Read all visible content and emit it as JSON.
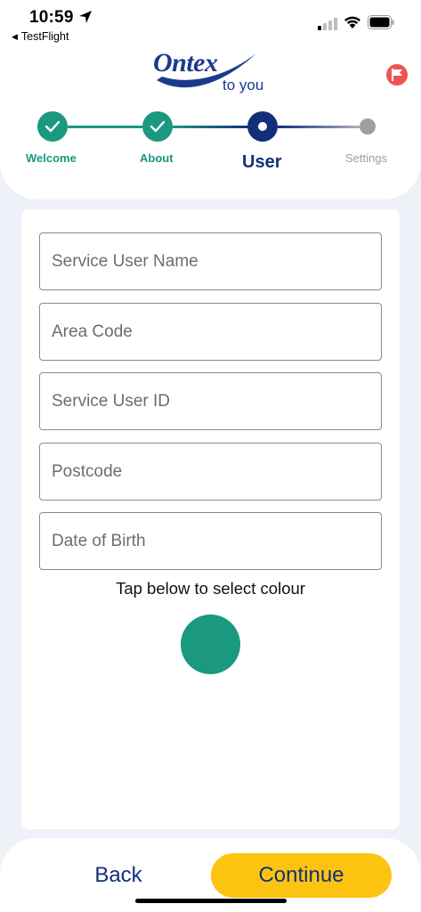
{
  "status_bar": {
    "time": "10:59",
    "back_app": "TestFlight",
    "location_icon": "location-arrow-icon",
    "signal_icon": "cellular-signal-icon",
    "wifi_icon": "wifi-icon",
    "battery_icon": "battery-icon"
  },
  "header": {
    "logo_word": "Ontex",
    "logo_sub": "to you",
    "flag_icon": "flag-icon"
  },
  "stepper": {
    "steps": [
      {
        "label": "Welcome",
        "state": "done"
      },
      {
        "label": "About",
        "state": "done"
      },
      {
        "label": "User",
        "state": "active"
      },
      {
        "label": "Settings",
        "state": "pending"
      }
    ]
  },
  "form": {
    "fields": [
      {
        "placeholder": "Service User Name",
        "value": ""
      },
      {
        "placeholder": "Area Code",
        "value": ""
      },
      {
        "placeholder": "Service User ID",
        "value": ""
      },
      {
        "placeholder": "Postcode",
        "value": ""
      },
      {
        "placeholder": "Date of Birth",
        "value": ""
      }
    ],
    "colour_prompt": "Tap below to select colour",
    "selected_colour": "#1a9880"
  },
  "footer": {
    "back_label": "Back",
    "continue_label": "Continue"
  },
  "colors": {
    "teal": "#1a9880",
    "navy": "#142f7a",
    "yellow": "#fcc411",
    "grey": "#9e9e9e"
  }
}
